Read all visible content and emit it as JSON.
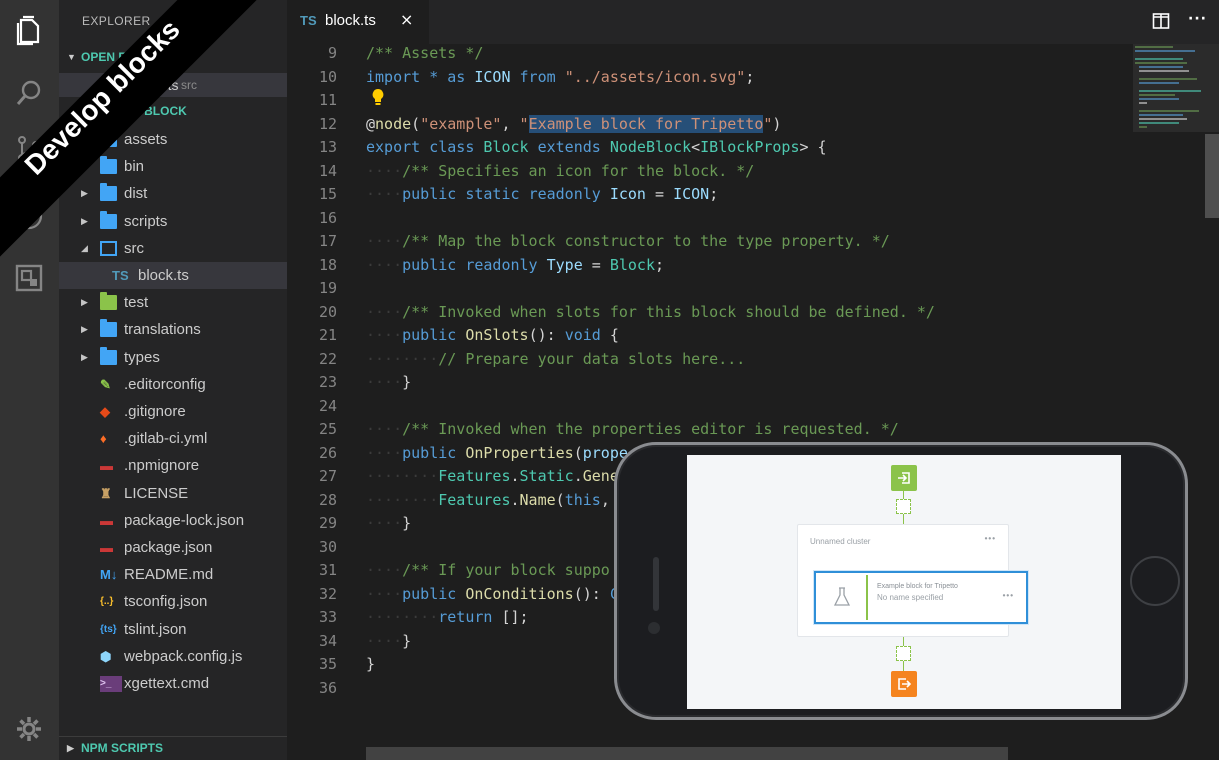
{
  "ribbon": {
    "text": "Develop blocks"
  },
  "sidebar": {
    "header": "EXPLORER",
    "open_editors": {
      "title": "OPEN EDITORS",
      "file": {
        "name": "block.ts",
        "dir": "src"
      }
    },
    "project": {
      "title": "TRIPETTO-BLOCK"
    },
    "tree": [
      {
        "label": "assets",
        "type": "folder"
      },
      {
        "label": "bin",
        "type": "folder"
      },
      {
        "label": "dist",
        "type": "folder"
      },
      {
        "label": "scripts",
        "type": "folder"
      },
      {
        "label": "src",
        "type": "folder-open"
      },
      {
        "label": "block.ts",
        "type": "ts-file"
      },
      {
        "label": "test",
        "type": "folder-test"
      },
      {
        "label": "translations",
        "type": "folder"
      },
      {
        "label": "types",
        "type": "folder"
      },
      {
        "label": ".editorconfig",
        "type": "editorconfig"
      },
      {
        "label": ".gitignore",
        "type": "git"
      },
      {
        "label": ".gitlab-ci.yml",
        "type": "gitlab"
      },
      {
        "label": ".npmignore",
        "type": "npm"
      },
      {
        "label": "LICENSE",
        "type": "license"
      },
      {
        "label": "package-lock.json",
        "type": "npm"
      },
      {
        "label": "package.json",
        "type": "npm"
      },
      {
        "label": "README.md",
        "type": "markdown"
      },
      {
        "label": "tsconfig.json",
        "type": "json"
      },
      {
        "label": "tslint.json",
        "type": "tslint"
      },
      {
        "label": "webpack.config.js",
        "type": "webpack"
      },
      {
        "label": "xgettext.cmd",
        "type": "cmd"
      }
    ],
    "npm_scripts": "NPM SCRIPTS"
  },
  "tab": {
    "lang_badge": "TS",
    "filename": "block.ts",
    "close": "×"
  },
  "editor": {
    "line_numbers": [
      "9",
      "10",
      "11",
      "12",
      "13",
      "14",
      "15",
      "16",
      "17",
      "18",
      "19",
      "20",
      "21",
      "22",
      "23",
      "24",
      "25",
      "26",
      "27",
      "28",
      "29",
      "30",
      "31",
      "32",
      "33",
      "34",
      "35",
      "36"
    ]
  },
  "phone_screen": {
    "cluster_title": "Unnamed cluster",
    "cluster_menu": "•••",
    "block_title": "Example block for Tripetto",
    "block_subtitle": "No name specified",
    "block_menu": "•••"
  },
  "colors": {
    "keyword": "#569cd6",
    "comment": "#6a9955",
    "string": "#ce9178",
    "type": "#4ec9b0",
    "accent_green": "#8bc34a",
    "accent_orange": "#f5841f",
    "selection": "#264f78"
  }
}
